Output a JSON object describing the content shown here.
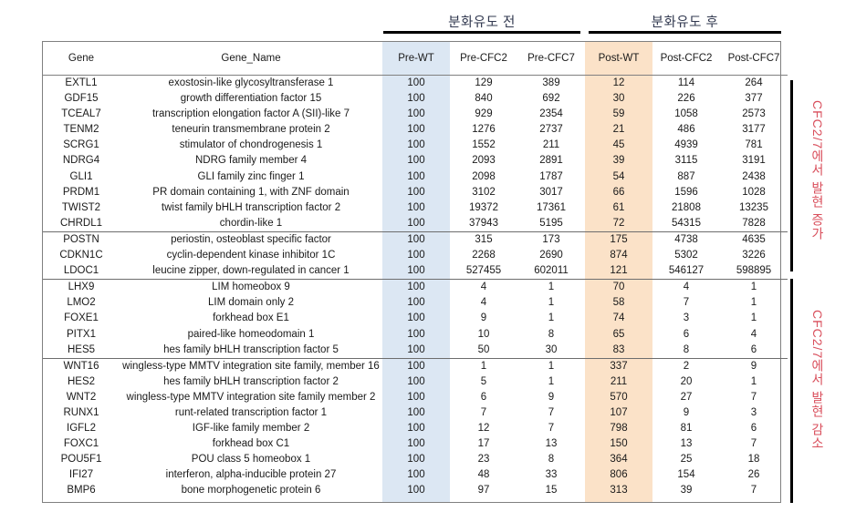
{
  "groups": {
    "pre_caption": "분화유도 전",
    "post_caption": "분화유도 후"
  },
  "side_labels": {
    "upregulated": "CFC2/7에서 발현 증가",
    "downregulated": "CFC2/7에서 발현 감소"
  },
  "colors": {
    "pre_wt_highlight": "#dce7f3",
    "post_wt_highlight": "#fbe2c8",
    "side_label_text": "#d94f5c",
    "caption_text": "#31384f",
    "rule": "#000000",
    "table_border": "#808080"
  },
  "table": {
    "headers": [
      "Gene",
      "Gene_Name",
      "Pre-WT",
      "Pre-CFC2",
      "Pre-CFC7",
      "Post-WT",
      "Post-CFC2",
      "Post-CFC7"
    ],
    "rows": [
      {
        "gene": "EXTL1",
        "name": "exostosin-like glycosyltransferase 1",
        "values": [
          "100",
          "129",
          "389",
          "12",
          "114",
          "264"
        ],
        "group_end": false
      },
      {
        "gene": "GDF15",
        "name": "growth differentiation factor 15",
        "values": [
          "100",
          "840",
          "692",
          "30",
          "226",
          "377"
        ],
        "group_end": false
      },
      {
        "gene": "TCEAL7",
        "name": "transcription elongation factor A (SII)-like 7",
        "values": [
          "100",
          "929",
          "2354",
          "59",
          "1058",
          "2573"
        ],
        "group_end": false
      },
      {
        "gene": "TENM2",
        "name": "teneurin transmembrane protein 2",
        "values": [
          "100",
          "1276",
          "2737",
          "21",
          "486",
          "3177"
        ],
        "group_end": false
      },
      {
        "gene": "SCRG1",
        "name": "stimulator of chondrogenesis 1",
        "values": [
          "100",
          "1552",
          "211",
          "45",
          "4939",
          "781"
        ],
        "group_end": false
      },
      {
        "gene": "NDRG4",
        "name": "NDRG family member 4",
        "values": [
          "100",
          "2093",
          "2891",
          "39",
          "3115",
          "3191"
        ],
        "group_end": false
      },
      {
        "gene": "GLI1",
        "name": "GLI family zinc finger 1",
        "values": [
          "100",
          "2098",
          "1787",
          "54",
          "887",
          "2438"
        ],
        "group_end": false
      },
      {
        "gene": "PRDM1",
        "name": "PR domain containing 1, with ZNF domain",
        "values": [
          "100",
          "3102",
          "3017",
          "66",
          "1596",
          "1028"
        ],
        "group_end": false
      },
      {
        "gene": "TWIST2",
        "name": "twist family bHLH transcription factor 2",
        "values": [
          "100",
          "19372",
          "17361",
          "61",
          "21808",
          "13235"
        ],
        "group_end": false
      },
      {
        "gene": "CHRDL1",
        "name": "chordin-like 1",
        "values": [
          "100",
          "37943",
          "5195",
          "72",
          "54315",
          "7828"
        ],
        "group_end": true
      },
      {
        "gene": "POSTN",
        "name": "periostin, osteoblast specific factor",
        "values": [
          "100",
          "315",
          "173",
          "175",
          "4738",
          "4635"
        ],
        "group_end": false
      },
      {
        "gene": "CDKN1C",
        "name": "cyclin-dependent kinase inhibitor 1C",
        "values": [
          "100",
          "2268",
          "2690",
          "874",
          "5302",
          "3226"
        ],
        "group_end": false
      },
      {
        "gene": "LDOC1",
        "name": "leucine zipper, down-regulated in cancer 1",
        "values": [
          "100",
          "527455",
          "602011",
          "121",
          "546127",
          "598895"
        ],
        "group_end": true
      },
      {
        "gene": "LHX9",
        "name": "LIM homeobox 9",
        "values": [
          "100",
          "4",
          "1",
          "70",
          "4",
          "1"
        ],
        "group_end": false
      },
      {
        "gene": "LMO2",
        "name": "LIM domain only 2",
        "values": [
          "100",
          "4",
          "1",
          "58",
          "7",
          "1"
        ],
        "group_end": false
      },
      {
        "gene": "FOXE1",
        "name": "forkhead box E1",
        "values": [
          "100",
          "9",
          "1",
          "74",
          "3",
          "1"
        ],
        "group_end": false
      },
      {
        "gene": "PITX1",
        "name": "paired-like homeodomain 1",
        "values": [
          "100",
          "10",
          "8",
          "65",
          "6",
          "4"
        ],
        "group_end": false
      },
      {
        "gene": "HES5",
        "name": "hes family bHLH transcription factor 5",
        "values": [
          "100",
          "50",
          "30",
          "83",
          "8",
          "6"
        ],
        "group_end": true
      },
      {
        "gene": "WNT16",
        "name": "wingless-type MMTV integration site family, member 16",
        "values": [
          "100",
          "1",
          "1",
          "337",
          "2",
          "9"
        ],
        "group_end": false
      },
      {
        "gene": "HES2",
        "name": "hes family bHLH transcription factor 2",
        "values": [
          "100",
          "5",
          "1",
          "211",
          "20",
          "1"
        ],
        "group_end": false
      },
      {
        "gene": "WNT2",
        "name": "wingless-type MMTV integration site family member 2",
        "values": [
          "100",
          "6",
          "9",
          "570",
          "27",
          "7"
        ],
        "group_end": false
      },
      {
        "gene": "RUNX1",
        "name": "runt-related transcription factor 1",
        "values": [
          "100",
          "7",
          "7",
          "107",
          "9",
          "3"
        ],
        "group_end": false
      },
      {
        "gene": "IGFL2",
        "name": "IGF-like family member 2",
        "values": [
          "100",
          "12",
          "7",
          "798",
          "81",
          "6"
        ],
        "group_end": false
      },
      {
        "gene": "FOXC1",
        "name": "forkhead box C1",
        "values": [
          "100",
          "17",
          "13",
          "150",
          "13",
          "7"
        ],
        "group_end": false
      },
      {
        "gene": "POU5F1",
        "name": "POU class 5 homeobox 1",
        "values": [
          "100",
          "23",
          "8",
          "364",
          "25",
          "18"
        ],
        "group_end": false
      },
      {
        "gene": "IFI27",
        "name": "interferon, alpha-inducible protein 27",
        "values": [
          "100",
          "48",
          "33",
          "806",
          "154",
          "26"
        ],
        "group_end": false
      },
      {
        "gene": "BMP6",
        "name": "bone morphogenetic protein 6",
        "values": [
          "100",
          "97",
          "15",
          "313",
          "39",
          "7"
        ],
        "group_end": false
      }
    ]
  }
}
